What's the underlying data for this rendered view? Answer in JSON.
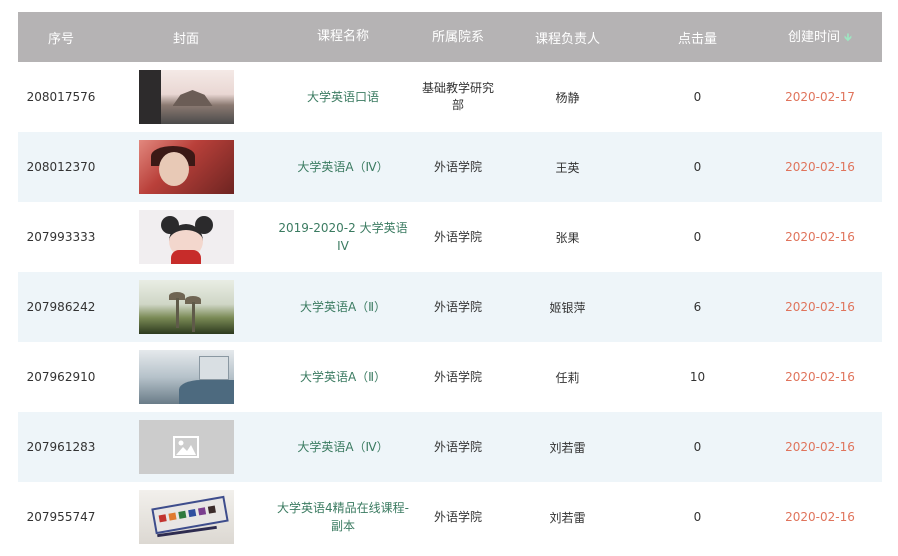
{
  "header": {
    "index": "序号",
    "cover": "封面",
    "course_name": "课程名称",
    "department": "所属院系",
    "owner": "课程负责人",
    "clicks": "点击量",
    "created": "创建时间",
    "sort_icon": "arrow-down-icon"
  },
  "rows": [
    {
      "index": "208017576",
      "course_name": "大学英语口语",
      "department": "基础教学研究部",
      "owner": "杨静",
      "clicks": "0",
      "created": "2020-02-17"
    },
    {
      "index": "208012370",
      "course_name": "大学英语A（Ⅳ）",
      "department": "外语学院",
      "owner": "王英",
      "clicks": "0",
      "created": "2020-02-16"
    },
    {
      "index": "207993333",
      "course_name": "2019-2020-2 大学英语 IV",
      "department": "外语学院",
      "owner": "张果",
      "clicks": "0",
      "created": "2020-02-16"
    },
    {
      "index": "207986242",
      "course_name": "大学英语A（Ⅱ）",
      "department": "外语学院",
      "owner": "姬银萍",
      "clicks": "6",
      "created": "2020-02-16"
    },
    {
      "index": "207962910",
      "course_name": "大学英语A（Ⅱ）",
      "department": "外语学院",
      "owner": "任莉",
      "clicks": "10",
      "created": "2020-02-16"
    },
    {
      "index": "207961283",
      "course_name": "大学英语A（Ⅳ）",
      "department": "外语学院",
      "owner": "刘若雷",
      "clicks": "0",
      "created": "2020-02-16"
    },
    {
      "index": "207955747",
      "course_name": "大学英语4精品在线课程-副本",
      "department": "外语学院",
      "owner": "刘若雷",
      "clicks": "0",
      "created": "2020-02-16"
    }
  ],
  "colors": {
    "header_bg": "#b5b3b4",
    "alt_row_bg": "#eef5f9",
    "course_link": "#3b7b61",
    "date": "#e0745c",
    "sort_arrow": "#9ee6c2"
  }
}
